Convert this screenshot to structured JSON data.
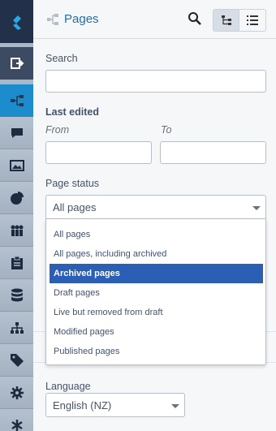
{
  "header": {
    "title": "Pages"
  },
  "filters": {
    "search_label": "Search",
    "last_edited_label": "Last edited",
    "from_label": "From",
    "to_label": "To",
    "page_status_label": "Page status",
    "page_status_value": "All pages",
    "page_status_options": [
      "All pages",
      "All pages, including archived",
      "Archived pages",
      "Draft pages",
      "Live but removed from draft",
      "Modified pages",
      "Published pages"
    ],
    "highlighted_option_index": 2,
    "language_label": "Language",
    "language_value": "English (NZ)"
  },
  "colors": {
    "sidebar_active": "#1d8ccc",
    "highlight": "#2b5fb5",
    "title": "#1d6fad"
  },
  "icons": [
    "logo-icon",
    "logout-icon",
    "site-tree-icon",
    "comment-icon",
    "image-icon",
    "pie-chart-icon",
    "people-icon",
    "clipboard-icon",
    "database-icon",
    "hierarchy-icon",
    "tag-icon",
    "gear-icon",
    "asterisk-icon"
  ]
}
